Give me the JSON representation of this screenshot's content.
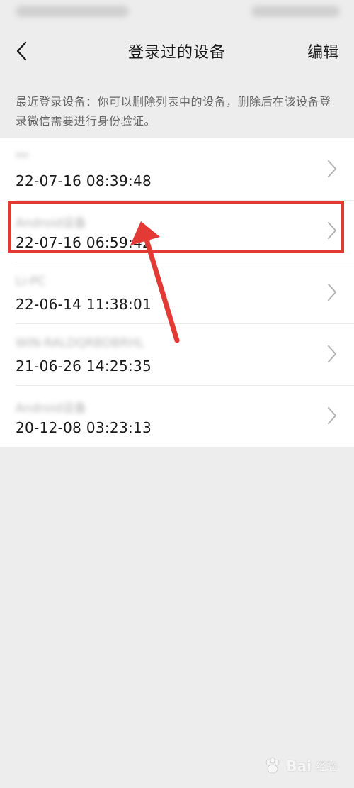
{
  "nav": {
    "title": "登录过的设备",
    "edit_label": "编辑",
    "back_icon": "chevron-left-icon"
  },
  "hint": "最近登录设备：你可以删除列表中的设备，删除后在该设备登录微信需要进行身份验证。",
  "devices": [
    {
      "name": "ᴹᴹ",
      "time": "22-07-16 08:39:48",
      "highlighted": false
    },
    {
      "name": "Android设备",
      "time": "22-07-16 06:59:42",
      "highlighted": true
    },
    {
      "name": "Li-PC",
      "time": "22-06-14 11:38:01",
      "highlighted": false
    },
    {
      "name": "WIN-RALDQRBDBRHL",
      "time": "21-06-26 14:25:35",
      "highlighted": false
    },
    {
      "name": "Android设备",
      "time": "20-12-08 03:23:13",
      "highlighted": false
    }
  ],
  "chevron_icon": "chevron-right-icon",
  "watermark": {
    "logo": "Bai",
    "sub": "经验"
  },
  "colors": {
    "background": "#ededed",
    "highlight": "#e33a36",
    "text": "#191919",
    "hint": "#666666"
  }
}
